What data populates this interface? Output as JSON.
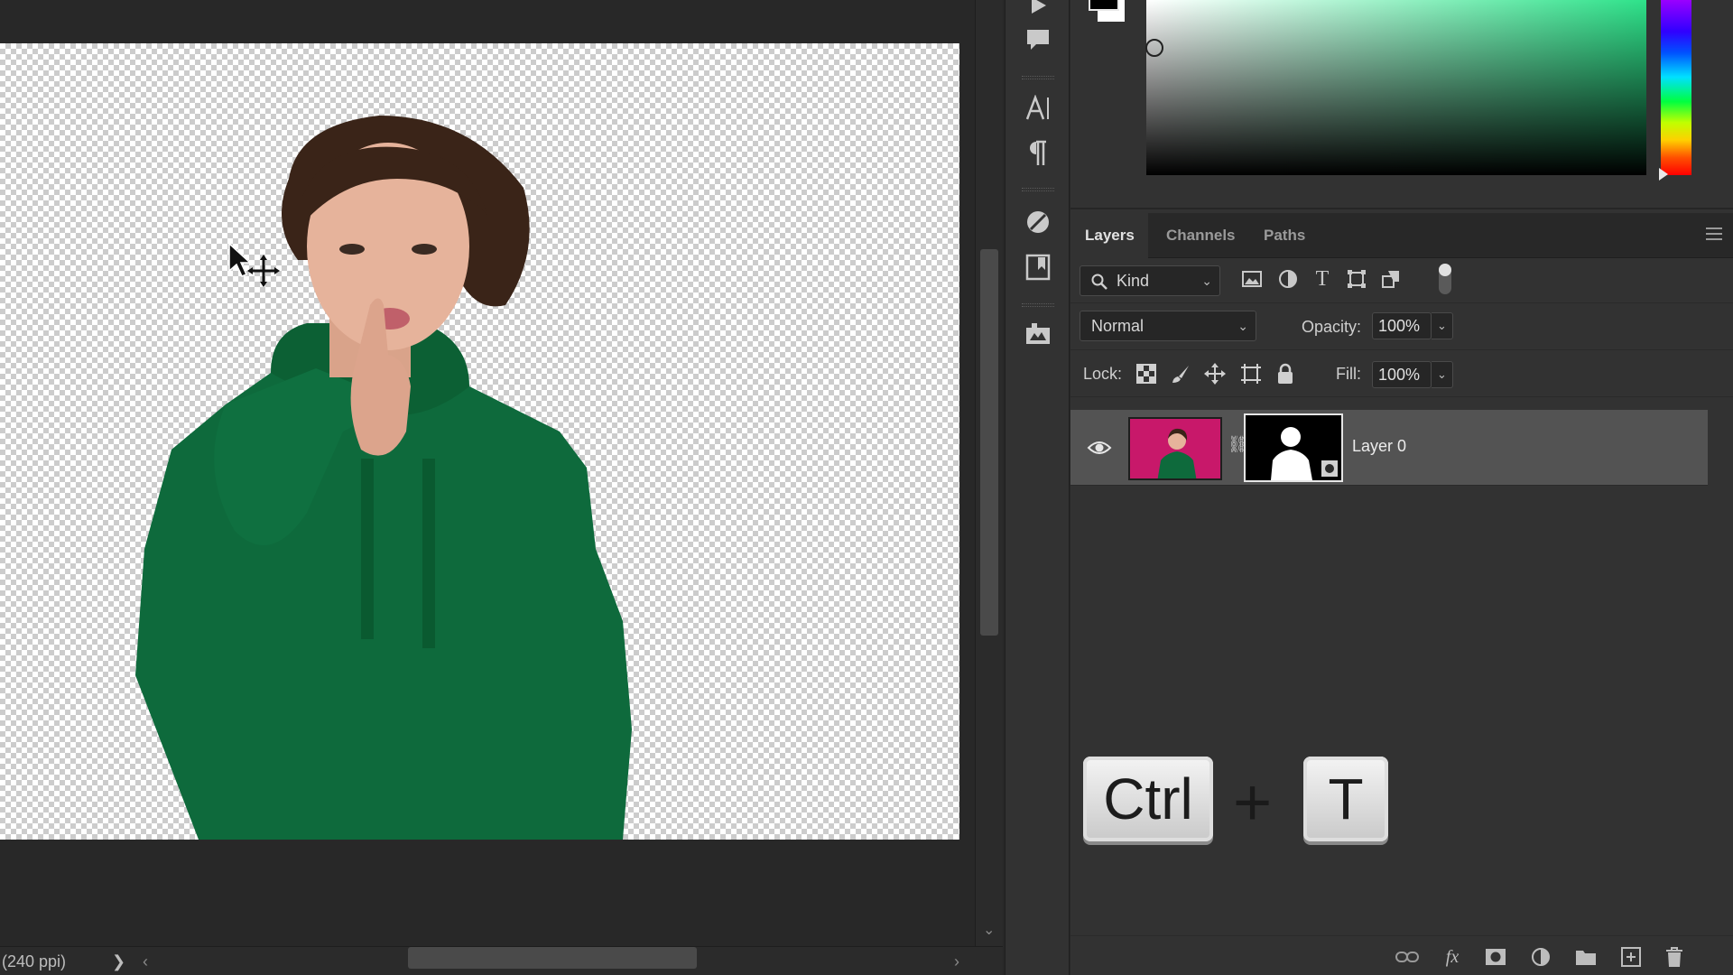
{
  "status": {
    "resolution": "(240 ppi)",
    "chevron": "❯"
  },
  "scrollbar": {
    "left_arrow": "‹",
    "right_arrow": "›",
    "down_arrow": "⌄"
  },
  "color_picker": {
    "foreground": "#000000",
    "background": "#ffffff",
    "hue": "#2ee28a"
  },
  "layers_panel": {
    "tabs": [
      {
        "label": "Layers",
        "active": true
      },
      {
        "label": "Channels",
        "active": false
      },
      {
        "label": "Paths",
        "active": false
      }
    ],
    "filter": {
      "label": "Kind"
    },
    "blend_mode": "Normal",
    "opacity_label": "Opacity:",
    "opacity_value": "100%",
    "lock_label": "Lock:",
    "fill_label": "Fill:",
    "fill_value": "100%",
    "layers": [
      {
        "name": "Layer 0",
        "visible": true,
        "has_mask": true
      }
    ]
  },
  "shortcut_overlay": {
    "key1": "Ctrl",
    "plus": "+",
    "key2": "T"
  },
  "canvas": {
    "subject": "woman in green hoodie making shush gesture",
    "background": "transparent"
  }
}
